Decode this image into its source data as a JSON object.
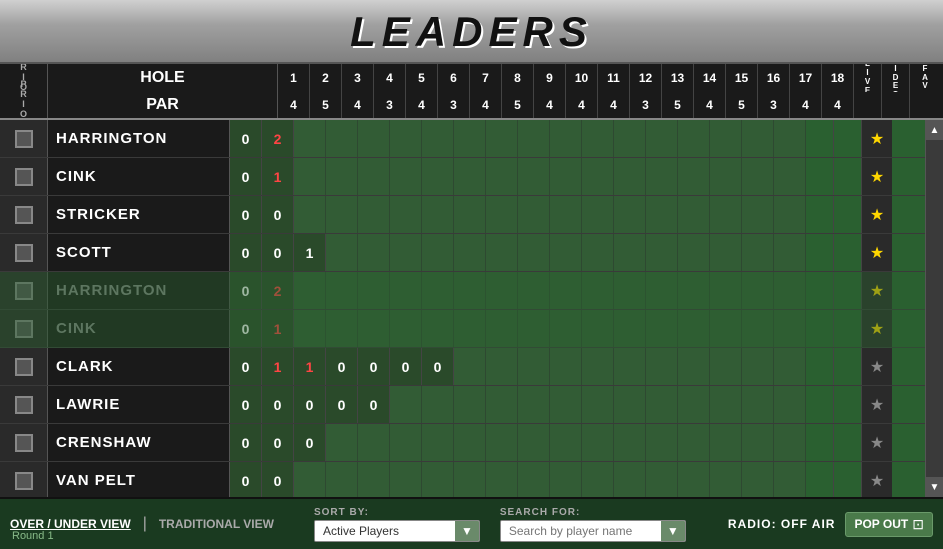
{
  "title": "LEADERS",
  "header": {
    "hole_label": "HOLE",
    "par_label": "PAR",
    "prior_label": "PRIOR",
    "live_label": "L\nI\nV\nE",
    "video_label": "V\nI\nD\nE\nO",
    "fav_label": "F\nA\nV",
    "holes": [
      1,
      2,
      3,
      4,
      5,
      6,
      7,
      8,
      9,
      10,
      11,
      12,
      13,
      14,
      15,
      16,
      17,
      18
    ],
    "pars": [
      4,
      5,
      4,
      3,
      4,
      3,
      4,
      5,
      4,
      4,
      4,
      3,
      5,
      4,
      5,
      3,
      4,
      4
    ]
  },
  "players": [
    {
      "name": "HARRINGTON",
      "scores": [
        0,
        2,
        null,
        null,
        null,
        null,
        null,
        null,
        null,
        null,
        null,
        null,
        null,
        null,
        null,
        null,
        null,
        null
      ],
      "score_colors": [
        "white",
        "red",
        "",
        "",
        "",
        "",
        "",
        "",
        "",
        "",
        "",
        "",
        "",
        "",
        "",
        "",
        "",
        ""
      ],
      "fav": true,
      "dim": false
    },
    {
      "name": "CINK",
      "scores": [
        0,
        1,
        null,
        null,
        null,
        null,
        null,
        null,
        null,
        null,
        null,
        null,
        null,
        null,
        null,
        null,
        null,
        null
      ],
      "score_colors": [
        "white",
        "red",
        "",
        "",
        "",
        "",
        "",
        "",
        "",
        "",
        "",
        "",
        "",
        "",
        "",
        "",
        "",
        ""
      ],
      "fav": true,
      "dim": false
    },
    {
      "name": "STRICKER",
      "scores": [
        0,
        0,
        null,
        null,
        null,
        null,
        null,
        null,
        null,
        null,
        null,
        null,
        null,
        null,
        null,
        null,
        null,
        null
      ],
      "score_colors": [
        "white",
        "white",
        "",
        "",
        "",
        "",
        "",
        "",
        "",
        "",
        "",
        "",
        "",
        "",
        "",
        "",
        "",
        ""
      ],
      "fav": true,
      "dim": false
    },
    {
      "name": "SCOTT",
      "scores": [
        0,
        0,
        1,
        null,
        null,
        null,
        null,
        null,
        null,
        null,
        null,
        null,
        null,
        null,
        null,
        null,
        null,
        null
      ],
      "score_colors": [
        "white",
        "white",
        "white",
        "",
        "",
        "",
        "",
        "",
        "",
        "",
        "",
        "",
        "",
        "",
        "",
        "",
        "",
        ""
      ],
      "fav": true,
      "dim": false
    },
    {
      "name": "HARRINGTON",
      "scores": [
        0,
        2,
        null,
        null,
        null,
        null,
        null,
        null,
        null,
        null,
        null,
        null,
        null,
        null,
        null,
        null,
        null,
        null
      ],
      "score_colors": [
        "white",
        "red",
        "",
        "",
        "",
        "",
        "",
        "",
        "",
        "",
        "",
        "",
        "",
        "",
        "",
        "",
        "",
        ""
      ],
      "fav": true,
      "dim": true
    },
    {
      "name": "CINK",
      "scores": [
        0,
        1,
        null,
        null,
        null,
        null,
        null,
        null,
        null,
        null,
        null,
        null,
        null,
        null,
        null,
        null,
        null,
        null
      ],
      "score_colors": [
        "white",
        "red",
        "",
        "",
        "",
        "",
        "",
        "",
        "",
        "",
        "",
        "",
        "",
        "",
        "",
        "",
        "",
        ""
      ],
      "fav": true,
      "dim": true
    },
    {
      "name": "CLARK",
      "scores": [
        0,
        1,
        1,
        0,
        0,
        0,
        0,
        null,
        null,
        null,
        null,
        null,
        null,
        null,
        null,
        null,
        null,
        null
      ],
      "score_colors": [
        "white",
        "red",
        "red",
        "white",
        "white",
        "white",
        "white",
        "",
        "",
        "",
        "",
        "",
        "",
        "",
        "",
        "",
        "",
        ""
      ],
      "fav": false,
      "dim": false
    },
    {
      "name": "LAWRIE",
      "scores": [
        0,
        0,
        0,
        0,
        0,
        null,
        null,
        null,
        null,
        null,
        null,
        null,
        null,
        null,
        null,
        null,
        null,
        null
      ],
      "score_colors": [
        "white",
        "white",
        "white",
        "white",
        "white",
        "",
        "",
        "",
        "",
        "",
        "",
        "",
        "",
        "",
        "",
        "",
        "",
        ""
      ],
      "fav": false,
      "dim": false
    },
    {
      "name": "CRENSHAW",
      "scores": [
        0,
        0,
        0,
        null,
        null,
        null,
        null,
        null,
        null,
        null,
        null,
        null,
        null,
        null,
        null,
        null,
        null,
        null
      ],
      "score_colors": [
        "white",
        "white",
        "white",
        "",
        "",
        "",
        "",
        "",
        "",
        "",
        "",
        "",
        "",
        "",
        "",
        "",
        "",
        ""
      ],
      "fav": false,
      "dim": false
    },
    {
      "name": "VAN PELT",
      "scores": [
        0,
        0,
        null,
        null,
        null,
        null,
        null,
        null,
        null,
        null,
        null,
        null,
        null,
        null,
        null,
        null,
        null,
        null
      ],
      "score_colors": [
        "white",
        "white",
        "",
        "",
        "",
        "",
        "",
        "",
        "",
        "",
        "",
        "",
        "",
        "",
        "",
        "",
        "",
        ""
      ],
      "fav": false,
      "dim": false
    }
  ],
  "footer": {
    "over_under_label": "OVER / UNDER VIEW",
    "traditional_label": "TRADITIONAL VIEW",
    "round_label": "Round 1",
    "sort_by_label": "SORT BY:",
    "sort_option": "Active Players",
    "search_label": "SEARCH FOR:",
    "search_placeholder": "Search by player name",
    "radio_label": "RADIO: OFF AIR",
    "pop_out_label": "POP OUT"
  }
}
